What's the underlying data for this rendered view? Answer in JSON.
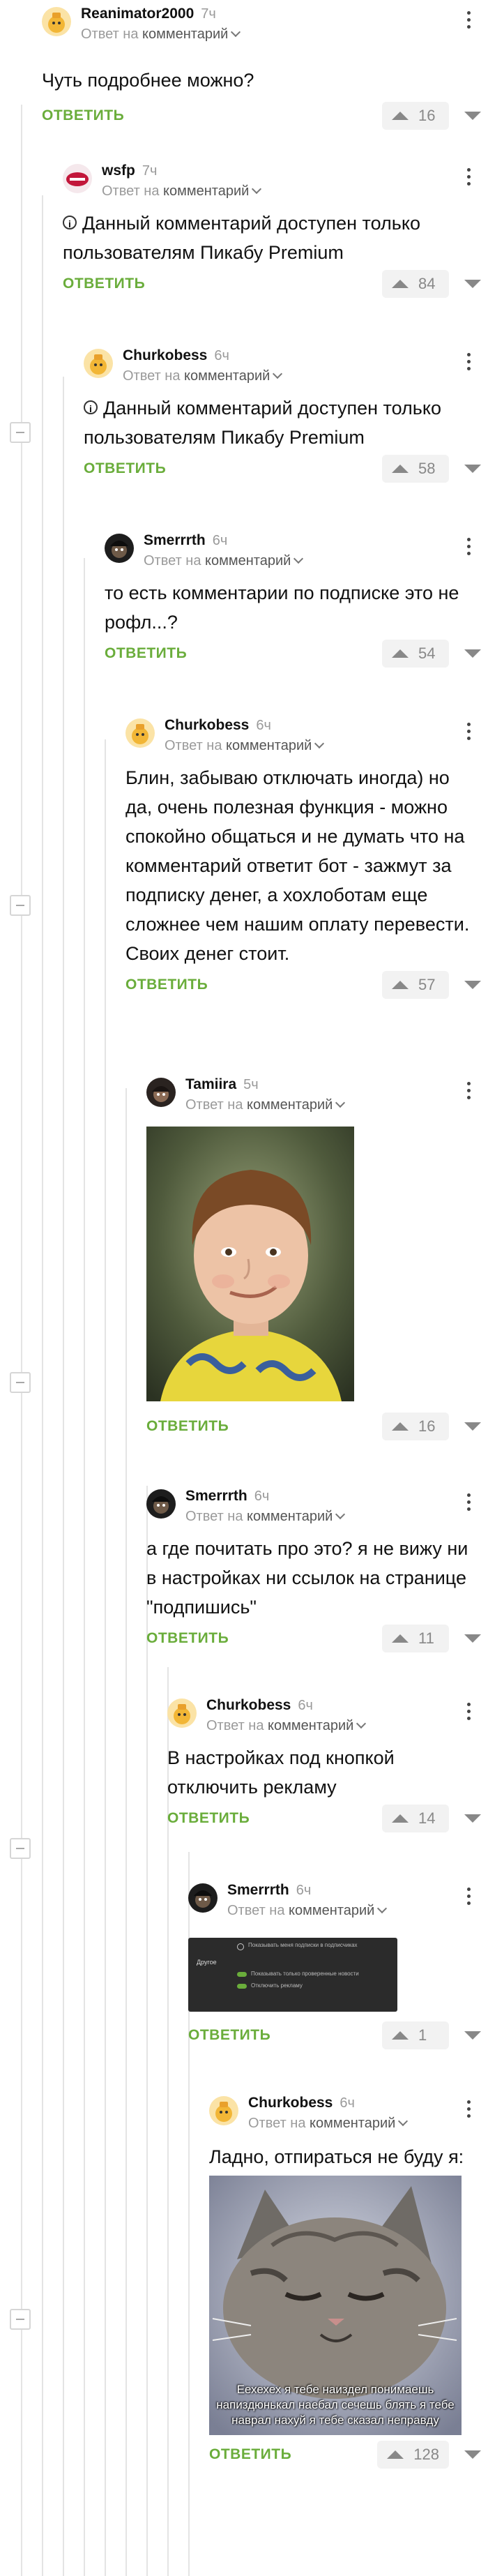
{
  "comments": [
    {
      "nick": "Reanimator2000",
      "time": "7ч",
      "reply_prefix": "Ответ на",
      "reply_target": "комментарий",
      "text": "Чуть подробнее можно?",
      "answer": "ОТВЕТИТЬ",
      "votes": "16"
    },
    {
      "nick": "wsfp",
      "time": "7ч",
      "reply_prefix": "Ответ на",
      "reply_target": "комментарий",
      "text": "Данный комментарий доступен только пользователям Пикабу Premium",
      "answer": "ОТВЕТИТЬ",
      "votes": "84"
    },
    {
      "nick": "Churkobess",
      "time": "6ч",
      "reply_prefix": "Ответ на",
      "reply_target": "комментарий",
      "text": "Данный комментарий доступен только пользователям Пикабу Premium",
      "answer": "ОТВЕТИТЬ",
      "votes": "58"
    },
    {
      "nick": "Smerrrth",
      "time": "6ч",
      "reply_prefix": "Ответ на",
      "reply_target": "комментарий",
      "text": "то есть комментарии по подписке это не рофл...?",
      "answer": "ОТВЕТИТЬ",
      "votes": "54"
    },
    {
      "nick": "Churkobess",
      "time": "6ч",
      "reply_prefix": "Ответ на",
      "reply_target": "комментарий",
      "text": "Блин, забываю отключать иногда) но да, очень полезная функция - можно спокойно общаться и не думать что на комментарий ответит бот - зажмут за подписку денег, а хохлоботам еще сложнее чем нашим оплату перевести. Своих денег стоит.",
      "answer": "ОТВЕТИТЬ",
      "votes": "57"
    },
    {
      "nick": "Tamiira",
      "time": "5ч",
      "reply_prefix": "Ответ на",
      "reply_target": "комментарий",
      "text": "",
      "answer": "ОТВЕТИТЬ",
      "votes": "16"
    },
    {
      "nick": "Smerrrth",
      "time": "6ч",
      "reply_prefix": "Ответ на",
      "reply_target": "комментарий",
      "text": "а где почитать про это? я не вижу ни в настройках ни ссылок на странице \"подпишись\"",
      "answer": "ОТВЕТИТЬ",
      "votes": "11"
    },
    {
      "nick": "Churkobess",
      "time": "6ч",
      "reply_prefix": "Ответ на",
      "reply_target": "комментарий",
      "text": "В настройках под кнопкой отключить рекламу",
      "answer": "ОТВЕТИТЬ",
      "votes": "14"
    },
    {
      "nick": "Smerrrth",
      "time": "6ч",
      "reply_prefix": "Ответ на",
      "reply_target": "комментарий",
      "text": "",
      "answer": "ОТВЕТИТЬ",
      "votes": "1"
    },
    {
      "nick": "Churkobess",
      "time": "6ч",
      "reply_prefix": "Ответ на",
      "reply_target": "комментарий",
      "text": "Ладно, отпираться не буду я:",
      "answer": "ОТВЕТИТЬ",
      "votes": "128"
    }
  ],
  "settings_screenshot": {
    "row1": "Показывать меня подписки в подписчиках",
    "section": "Другое",
    "row2": "Показывать только проверенные новости",
    "row3": "Отключить рекламу"
  },
  "meme_caption": "Еехехех я тебе наиздел понимаешь напиздюнькал наебал сечешь блять я тебе наврал нахуй я тебе сказал неправду",
  "colors": {
    "accent_green": "#6aad3b",
    "muted": "#9a9a9a"
  }
}
